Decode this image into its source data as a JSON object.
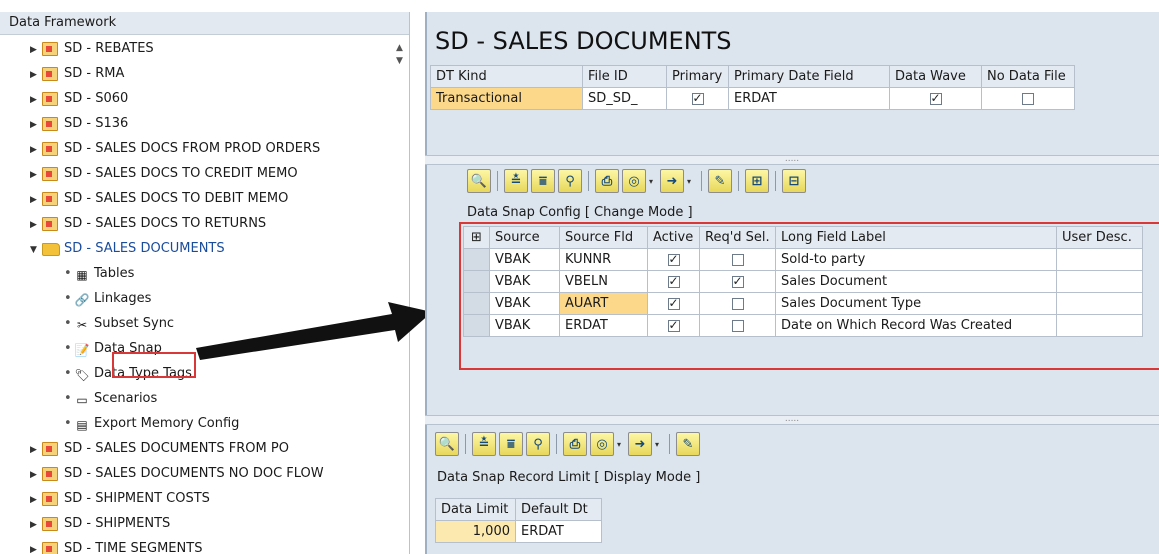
{
  "left_panel": {
    "title": "Data Framework",
    "items_before": [
      "SD - REBATES",
      "SD - RMA",
      "SD - S060",
      "SD - S136",
      "SD - SALES DOCS FROM PROD ORDERS",
      "SD - SALES DOCS TO CREDIT MEMO",
      "SD - SALES DOCS TO DEBIT MEMO",
      "SD - SALES DOCS TO RETURNS"
    ],
    "expanded_item": "SD - SALES DOCUMENTS",
    "children": [
      {
        "label": "Tables",
        "icon": "table-icon"
      },
      {
        "label": "Linkages",
        "icon": "link-icon"
      },
      {
        "label": "Subset Sync",
        "icon": "scissors-icon"
      },
      {
        "label": "Data Snap",
        "icon": "data-snap-icon"
      },
      {
        "label": "Data Type Tags",
        "icon": "tags-icon"
      },
      {
        "label": "Scenarios",
        "icon": "scenario-icon"
      },
      {
        "label": "Export Memory Config",
        "icon": "export-memory-icon"
      }
    ],
    "items_after": [
      "SD - SALES DOCUMENTS FROM PO",
      "SD - SALES DOCUMENTS NO DOC FLOW",
      "SD - SHIPMENT COSTS",
      "SD - SHIPMENTS",
      "SD - TIME SEGMENTS"
    ]
  },
  "top_panel": {
    "title": "SD - SALES DOCUMENTS",
    "headers": [
      "DT Kind",
      "File ID",
      "Primary",
      "Primary Date Field",
      "Data Wave",
      "No Data File"
    ],
    "row": {
      "dt_kind": "Transactional",
      "file_id": "SD_SD_",
      "primary": true,
      "primary_date_field": "ERDAT",
      "data_wave": true,
      "no_data_file": false
    }
  },
  "snap_panel": {
    "caption": "Data Snap Config [ Change Mode ]",
    "headers": [
      "Source",
      "Source Fld",
      "Active",
      "Req'd Sel.",
      "Long Field Label",
      "User Desc."
    ],
    "rows": [
      {
        "source": "VBAK",
        "field": "KUNNR",
        "active": true,
        "reqd": false,
        "label": "Sold-to party",
        "desc": ""
      },
      {
        "source": "VBAK",
        "field": "VBELN",
        "active": true,
        "reqd": true,
        "label": "Sales Document",
        "desc": ""
      },
      {
        "source": "VBAK",
        "field": "AUART",
        "active": true,
        "reqd": false,
        "label": "Sales Document Type",
        "desc": ""
      },
      {
        "source": "VBAK",
        "field": "ERDAT",
        "active": true,
        "reqd": false,
        "label": "Date on Which Record Was Created",
        "desc": ""
      }
    ]
  },
  "limit_panel": {
    "caption": "Data Snap Record Limit [ Display Mode ]",
    "headers": [
      "Data Limit",
      "Default Dt"
    ],
    "row": {
      "limit": "1,000",
      "default_dt": "ERDAT"
    }
  },
  "colors": {
    "highlight_red": "#d93838",
    "selection_yellow": "#fbd88a",
    "panel_bg": "#dce4ed"
  }
}
